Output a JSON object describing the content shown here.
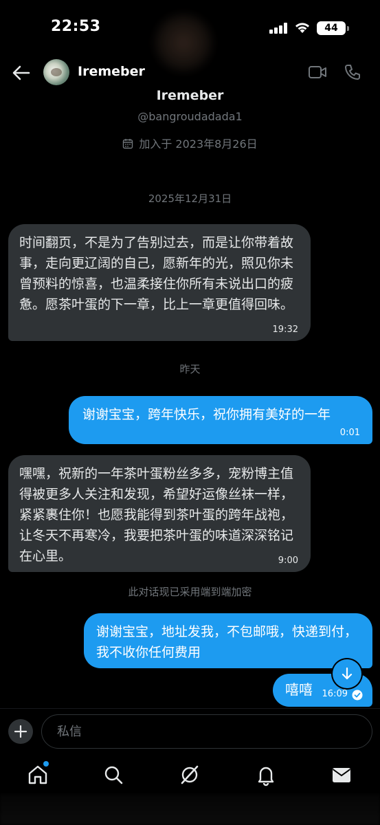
{
  "status": {
    "time": "22:53",
    "battery": "44"
  },
  "header": {
    "name": "Iremeber"
  },
  "profile": {
    "name": "Iremeber",
    "handle": "@bangroudadada1",
    "joined": "加入于 2023年8月26日"
  },
  "conversation": {
    "date1": "2025年12月31日",
    "msg1": {
      "text": "时间翻页，不是为了告别过去，而是让你带着故事，走向更辽阔的自己，愿新年的光，照见你未曾预料的惊喜，也温柔接住你所有未说出口的疲惫。愿茶叶蛋的下一章，比上一章更值得回味。",
      "time": "19:32"
    },
    "date2": "昨天",
    "msg2": {
      "text": "谢谢宝宝，跨年快乐，祝你拥有美好的一年",
      "time": "0:01"
    },
    "msg3": {
      "text": "嘿嘿，祝新的一年茶叶蛋粉丝多多，宠粉博主值得被更多人关注和发现，希望好运像丝袜一样，紧紧裹住你！也愿我能得到茶叶蛋的跨年战袍，让冬天不再寒冷，我要把茶叶蛋的味道深深铭记在心里。",
      "time": "9:00"
    },
    "encryption_note": "此对话现已采用端到端加密",
    "msg4": {
      "text": "谢谢宝宝，地址发我，不包邮哦，快递到付，我不收你任何费用"
    },
    "msg5": {
      "text": "嘻嘻",
      "time": "16:09"
    }
  },
  "composer": {
    "placeholder": "私信"
  },
  "colors": {
    "accent": "#1d9bf0",
    "incoming": "#2f3336",
    "muted": "#71767b"
  },
  "icons": [
    "back-arrow-icon",
    "video-call-icon",
    "phone-icon",
    "calendar-icon",
    "arrow-down-icon",
    "plus-icon",
    "home-icon",
    "search-icon",
    "grok-icon",
    "bell-icon",
    "mail-icon",
    "checkmark-icon"
  ]
}
